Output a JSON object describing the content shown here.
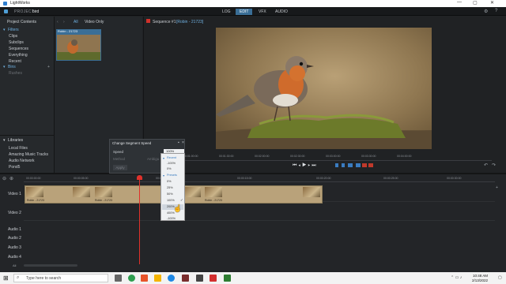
{
  "window": {
    "title": "LightWorks",
    "controls": [
      "—",
      "▢",
      "✕"
    ]
  },
  "header": {
    "project_label": "PROJECT",
    "project_name": "bird",
    "tabs": [
      {
        "label": "LOG",
        "active": false
      },
      {
        "label": "EDIT",
        "active": true
      },
      {
        "label": "VFX",
        "active": false
      },
      {
        "label": "AUDIO",
        "active": false
      }
    ]
  },
  "project_contents": {
    "title": "Project Contents",
    "filters_title": "Filters",
    "filters": [
      "Clips",
      "Subclips",
      "Sequences",
      "Everything",
      "Recent"
    ],
    "bins_title": "Bins",
    "bins": [
      "Rushes"
    ],
    "toolbar": {
      "all_label": "All",
      "video_only_label": "Video Only"
    },
    "clip_name": "Robin - 21723"
  },
  "libraries": {
    "title": "Libraries",
    "items": [
      "Local Files",
      "Amazing Music Tracks",
      "Audio Network",
      "Pond5"
    ]
  },
  "viewer": {
    "title": "Sequence #1",
    "clip": "[Robin - 21723]",
    "time_marks": [
      "00:01:00:00",
      "00:01:30:00",
      "00:02:00:00",
      "00:02:30:00",
      "00:03:00:00",
      "00:03:30:00",
      "00:04:00:00"
    ]
  },
  "dialog": {
    "title": "Change Segment Speed",
    "speed_label": "Speed",
    "speed_value": "100%",
    "method_label": "Method",
    "method_value": "Ambigu",
    "apply_label": "Apply"
  },
  "speed_menu": {
    "recent_header": "Recent",
    "recent": [
      "-100%",
      "0%"
    ],
    "presets_header": "Presets",
    "presets": [
      "0%",
      "25%",
      "50%",
      "100%",
      "200%",
      "400%",
      "-100%"
    ],
    "checked": "100%"
  },
  "timeline": {
    "ruler": [
      "00:00:00:00",
      "00:00:05:00",
      "00:00:10:00",
      "00:00:15:00",
      "00:00:20:00",
      "00:00:25:00",
      "00:00:30:00"
    ],
    "tracks": [
      "Video 1",
      "Video 2",
      "Audio 1",
      "Audio 2",
      "Audio 3",
      "Audio 4"
    ],
    "clip_label": "Robin - 21723",
    "footer_label": "All"
  },
  "taskbar": {
    "search_placeholder": "Type here to search",
    "time": "10:48 AM",
    "date": "2/13/2022"
  },
  "colors": {
    "accent": "#3a6e96",
    "playhead": "#e0312b",
    "clip": "#b9a27a"
  }
}
